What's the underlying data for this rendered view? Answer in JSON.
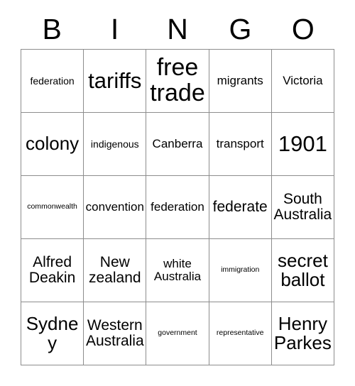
{
  "card": {
    "title": "BINGO",
    "headers": [
      "B",
      "I",
      "N",
      "G",
      "O"
    ],
    "rows": [
      [
        {
          "text": "federation",
          "size": "s-sm"
        },
        {
          "text": "tariffs",
          "size": "s-xxl"
        },
        {
          "text": "free trade",
          "size": "s-max"
        },
        {
          "text": "migrants",
          "size": "s-md"
        },
        {
          "text": "Victoria",
          "size": "s-md"
        }
      ],
      [
        {
          "text": "colony",
          "size": "s-xl"
        },
        {
          "text": "indigenous",
          "size": "s-sm"
        },
        {
          "text": "Canberra",
          "size": "s-md"
        },
        {
          "text": "transport",
          "size": "s-md"
        },
        {
          "text": "1901",
          "size": "s-xxl"
        }
      ],
      [
        {
          "text": "commonwealth",
          "size": "s-xs"
        },
        {
          "text": "convention",
          "size": "s-md"
        },
        {
          "text": "federation",
          "size": "s-md"
        },
        {
          "text": "federate",
          "size": "s-lg"
        },
        {
          "text": "South Australia",
          "size": "s-lg"
        }
      ],
      [
        {
          "text": "Alfred Deakin",
          "size": "s-lg"
        },
        {
          "text": "New zealand",
          "size": "s-lg"
        },
        {
          "text": "white Australia",
          "size": "s-md"
        },
        {
          "text": "immigration",
          "size": "s-xs"
        },
        {
          "text": "secret ballot",
          "size": "s-xl"
        }
      ],
      [
        {
          "text": "Sydney",
          "size": "s-xl"
        },
        {
          "text": "Western Australia",
          "size": "s-lg"
        },
        {
          "text": "government",
          "size": "s-xs"
        },
        {
          "text": "representative",
          "size": "s-xs"
        },
        {
          "text": "Henry Parkes",
          "size": "s-xl"
        }
      ]
    ]
  },
  "colors": {
    "background": "#ffffff",
    "text": "#000000",
    "grid_line": "#8d8d8d"
  }
}
